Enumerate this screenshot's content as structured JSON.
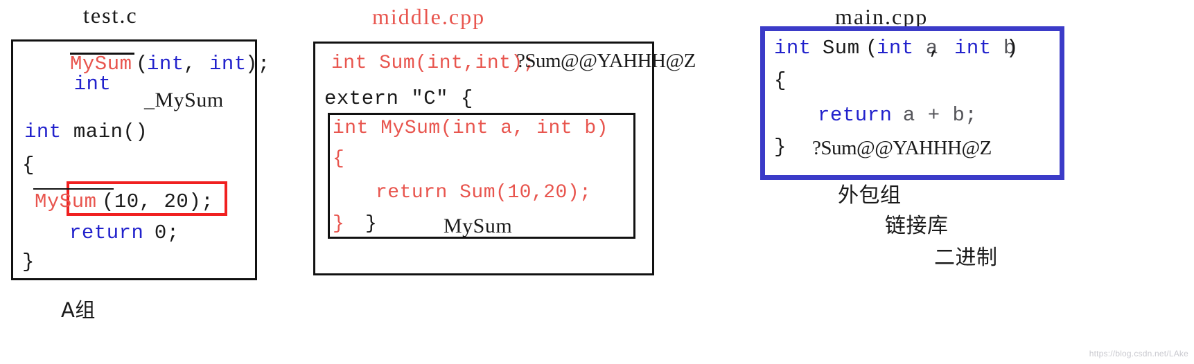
{
  "diagram": {
    "title_watermark": "https://blog.csdn.net/LAke",
    "colors": {
      "keyword_blue": "#2222cc",
      "code_red": "#e8554e",
      "text_black": "#1a1a1a",
      "highlight_red_box": "#f02020",
      "panel_blue_border": "#3b3bc8",
      "panel_black_border": "#111111"
    }
  },
  "panel_left": {
    "title": "test.c",
    "group_label": "A组",
    "lines": {
      "l1_kw1": "int",
      "l1_name": "MySum",
      "l1_open": "(",
      "l1_kw2": "int",
      "l1_comma": ", ",
      "l1_kw3": "int",
      "l1_close": ");",
      "l2_decorated": "_MySum",
      "l3_kw": "int",
      "l3_rest": " main()",
      "l4_brace": "{",
      "l5_name": "MySum",
      "l5_rest": "(10, 20);",
      "l6_kw": "return",
      "l6_rest": " 0;",
      "l7_brace": "}"
    }
  },
  "panel_middle": {
    "title": "middle.cpp",
    "lines": {
      "l1_decl": "int Sum(int,int);",
      "l1_mangled": "?Sum@@YAHHH@Z",
      "l2_extern": "extern \"C\" {",
      "inner_l1": "int MySum(int a, int b)",
      "inner_l2": "{",
      "inner_l3": "return Sum(10,20);",
      "inner_l4_brace_red": "}",
      "inner_l4_brace_black": "}",
      "inner_l4_symbol": "MySum"
    }
  },
  "panel_right": {
    "title": "main.cpp",
    "lines": {
      "l1_kw1": "int",
      "l1_name": " Sum",
      "l1_open": "(",
      "l1_kw2": "int",
      "l1_a": " a",
      "l1_comma": ", ",
      "l1_kw3": "int",
      "l1_b": " b",
      "l1_close": ")",
      "l2_brace": "{",
      "l3_kw": "return",
      "l3_rest": " a + b;",
      "l4_brace": "}",
      "l4_mangled": "?Sum@@YAHHH@Z"
    },
    "labels": [
      "外包组",
      "链接库",
      "二进制"
    ]
  }
}
